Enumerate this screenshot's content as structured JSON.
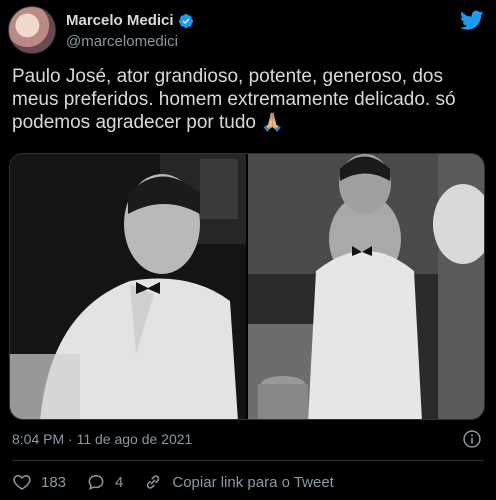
{
  "author": {
    "name": "Marcelo Medici",
    "handle": "@marcelomedici",
    "avatar_icon": "avatar",
    "verified_icon": "verified-badge-icon"
  },
  "tweet": {
    "text": "Paulo José, ator grandioso, potente, generoso, dos meus preferidos. homem extremamente delicado. só podemos agradecer por tudo",
    "emoji": "🙏🏼",
    "timestamp": "8:04 PM · 11 de ago de 2021"
  },
  "actions": {
    "likes": "183",
    "replies": "4",
    "copy_link": "Copiar link para o Tweet"
  },
  "colors": {
    "background": "#000000",
    "text": "#d9d9d9",
    "muted": "#8b98a5",
    "accent": "#1d9bf0"
  }
}
